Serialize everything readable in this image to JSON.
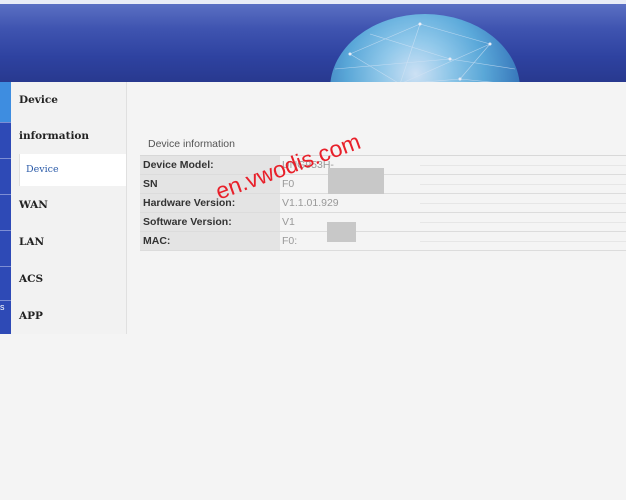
{
  "banner": {
    "graphic": "globe-network-graphic"
  },
  "sidebar": {
    "items": [
      {
        "label": "Device"
      },
      {
        "label": "information"
      },
      {
        "label": "WAN"
      },
      {
        "label": "LAN"
      },
      {
        "label": "ACS"
      },
      {
        "label": "APP"
      }
    ],
    "sub_item": {
      "label": "Device"
    },
    "left_strip_fragment": "s"
  },
  "main": {
    "section_title": "Device information",
    "rows": [
      {
        "key": "Device Model:",
        "value": "UNG953H-"
      },
      {
        "key": "SN",
        "value": "F0"
      },
      {
        "key": "Hardware Version:",
        "value": "V1.1.01.929"
      },
      {
        "key": "Software Version:",
        "value": "V1"
      },
      {
        "key": "MAC:",
        "value": "F0:"
      }
    ]
  },
  "watermark": {
    "text": "en.vwodis.com"
  },
  "colors": {
    "banner": "#2e42a0",
    "accent": "#3e8de0",
    "watermark": "#e8202a"
  }
}
